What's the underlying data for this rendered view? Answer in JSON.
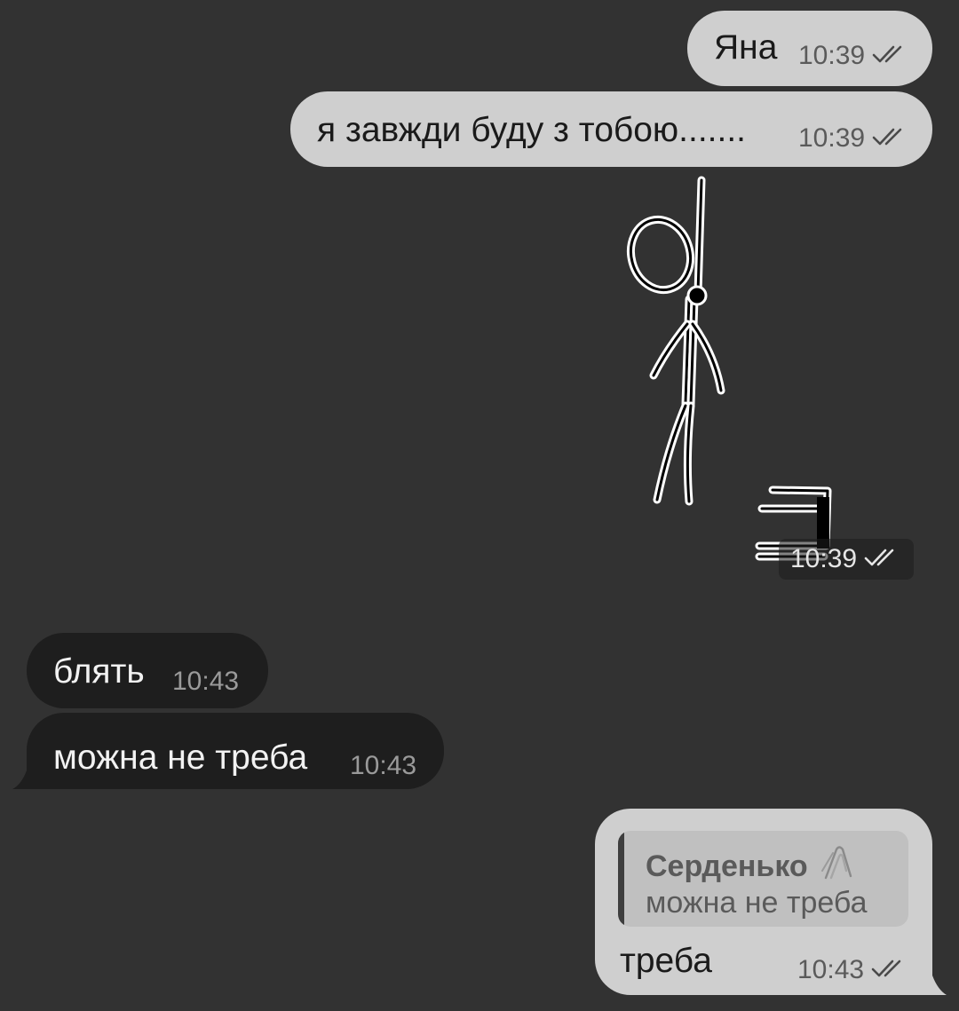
{
  "messages": [
    {
      "direction": "outgoing",
      "text": "Яна",
      "time": "10:39",
      "status": "double-check-icon"
    },
    {
      "direction": "outgoing",
      "text": "я завжди буду з тобою.......",
      "time": "10:39",
      "status": "double-check-icon"
    },
    {
      "direction": "outgoing",
      "type": "sticker",
      "sticker": "hanging-stick-figure-drawing",
      "time": "10:39",
      "status": "double-check-icon"
    },
    {
      "direction": "incoming",
      "text": "блять",
      "time": "10:43"
    },
    {
      "direction": "incoming",
      "text": "можна не треба",
      "time": "10:43"
    },
    {
      "direction": "outgoing",
      "reply_to": {
        "sender": "Серденько",
        "sender_icon": "paperclips-icon",
        "text": "можна не треба"
      },
      "text": "треба",
      "time": "10:43",
      "status": "double-check-icon"
    }
  ],
  "colors": {
    "background": "#323232",
    "outgoing_bubble": "#cfcfcf",
    "incoming_bubble": "#1e1e1e",
    "reply_preview": "#c0c0c0"
  }
}
